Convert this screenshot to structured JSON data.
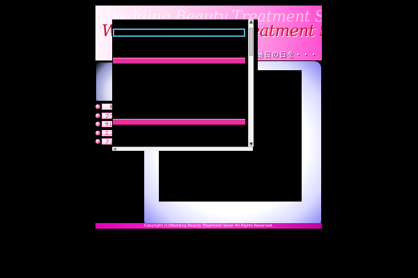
{
  "header": {
    "title": "Wedding Beauty Treatment Salon",
    "subtitle": "最高のコンディションで最良の日を・・・"
  },
  "nav": {
    "items": [
      {
        "label": "home"
      },
      {
        "label": "ブライダルエステとは"
      },
      {
        "label": "サロンの選び方"
      },
      {
        "label": "エステスケジュール"
      },
      {
        "label": "フェイシャルケア"
      }
    ]
  },
  "content": {
    "input_value": ""
  },
  "scrollbar": {
    "up_arrow": "▲",
    "down_arrow": "▼",
    "left_arrow": "◄"
  },
  "footer": {
    "copyright": "Copyright (C)Wedding Beauty Treatment Salon All Rights Reserved."
  },
  "colors": {
    "background": "#000000",
    "banner_gradient_end": "#ff4fd0",
    "title_red": "#c8102e",
    "accent_pink": "#e6319c",
    "input_border": "#4fb6d8",
    "frame_glow": "#8080f0",
    "footer_magenta": "#e000b8"
  }
}
